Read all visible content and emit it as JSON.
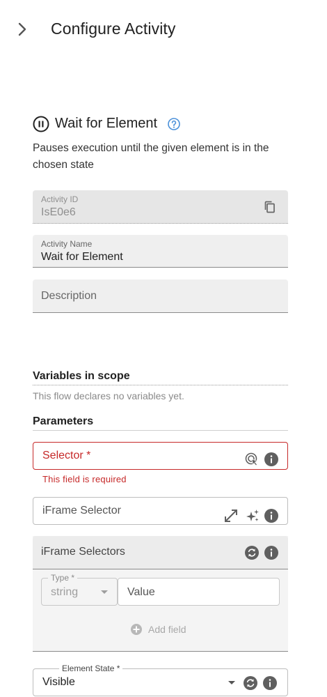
{
  "header": {
    "title": "Configure Activity",
    "toggle_icon": "chevron-right-icon"
  },
  "activity": {
    "icon": "pause-circle-icon",
    "title": "Wait for Element",
    "help_icon": "help-circle-icon",
    "description": "Pauses execution until the given element is in the chosen state"
  },
  "fields": {
    "activity_id": {
      "label": "Activity ID",
      "value": "IsE0e6",
      "icon": "copy-icon"
    },
    "activity_name": {
      "label": "Activity Name",
      "value": "Wait for Element"
    },
    "description": {
      "placeholder": "Description"
    }
  },
  "variables": {
    "title": "Variables in scope",
    "empty_note": "This flow declares no variables yet."
  },
  "parameters": {
    "title": "Parameters",
    "selector": {
      "label": "Selector *",
      "error": "This field is required",
      "icons": [
        "target-pick-icon",
        "info-icon"
      ]
    },
    "iframe_selector": {
      "label": "iFrame Selector",
      "icons": [
        "expand-icon",
        "sparkle-icon",
        "info-icon"
      ]
    },
    "iframe_selectors": {
      "title": "iFrame Selectors",
      "icons": [
        "refresh-icon",
        "info-icon"
      ],
      "type_label": "Type *",
      "type_value": "string",
      "value_placeholder": "Value",
      "add_field_label": "Add field"
    },
    "element_state": {
      "label": "Element State *",
      "value": "Visible",
      "icons": [
        "refresh-icon",
        "info-icon"
      ]
    }
  },
  "colors": {
    "error": "#c62828",
    "accent": "#4a90d9",
    "icon_gray": "#5f5f5f"
  }
}
